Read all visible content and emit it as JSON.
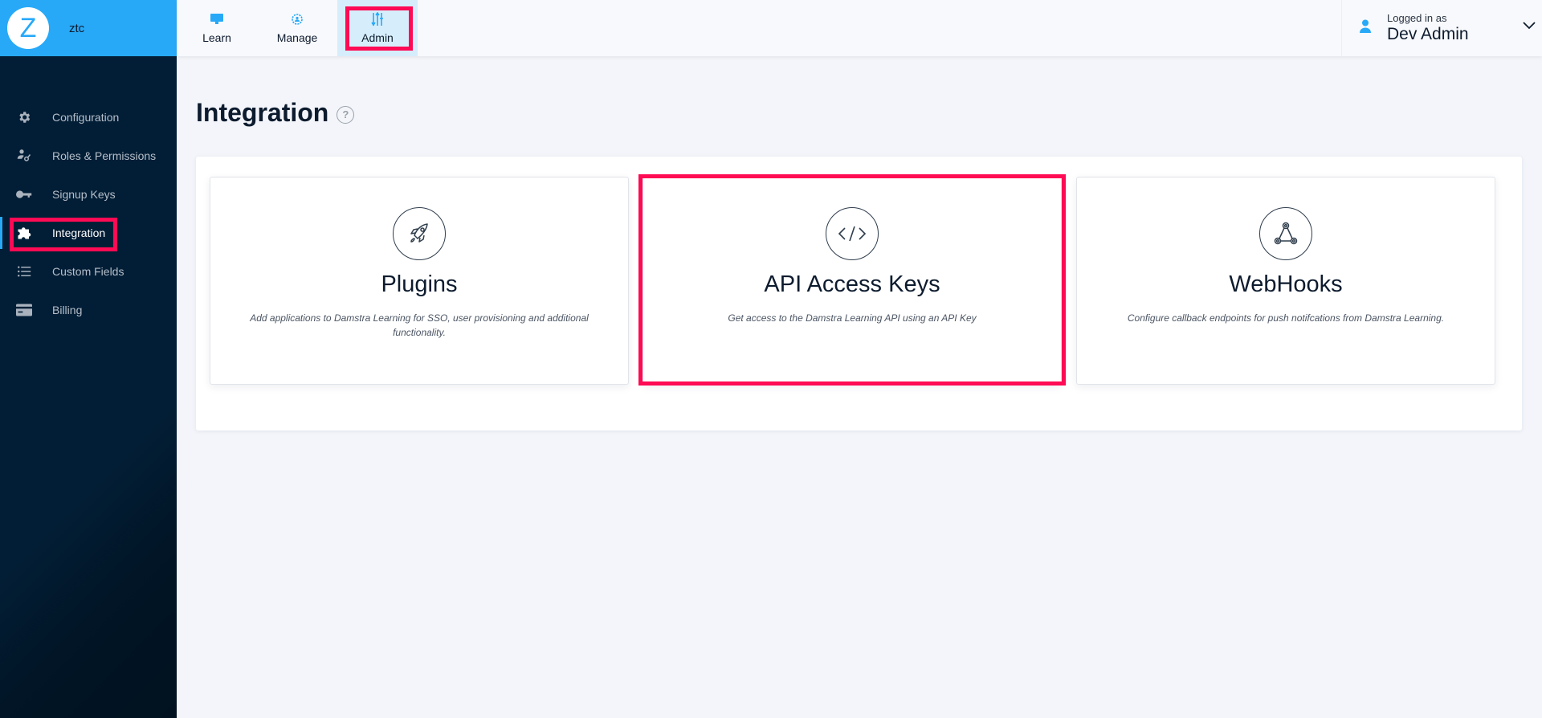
{
  "brand": {
    "logo_letter": "Z",
    "org_name": "ztc"
  },
  "nav": {
    "tabs": [
      {
        "label": "Learn",
        "icon": "monitor-icon",
        "active": false
      },
      {
        "label": "Manage",
        "icon": "gear-person-icon",
        "active": false
      },
      {
        "label": "Admin",
        "icon": "sliders-icon",
        "active": true
      }
    ]
  },
  "user": {
    "prefix": "Logged in as",
    "name": "Dev Admin",
    "icon": "user-icon",
    "menu_icon": "chevron-down-icon"
  },
  "sidebar": {
    "items": [
      {
        "label": "Configuration",
        "icon": "gear-icon",
        "active": false
      },
      {
        "label": "Roles & Permissions",
        "icon": "user-key-icon",
        "active": false
      },
      {
        "label": "Signup Keys",
        "icon": "key-icon",
        "active": false
      },
      {
        "label": "Integration",
        "icon": "puzzle-icon",
        "active": true
      },
      {
        "label": "Custom Fields",
        "icon": "list-icon",
        "active": false
      },
      {
        "label": "Billing",
        "icon": "credit-card-icon",
        "active": false
      }
    ]
  },
  "page": {
    "title": "Integration",
    "help_glyph": "?"
  },
  "cards": [
    {
      "title": "Plugins",
      "icon": "rocket-icon",
      "description": "Add applications to Damstra Learning for SSO, user provisioning and additional functionality."
    },
    {
      "title": "API Access Keys",
      "icon": "code-icon",
      "description": "Get access to the Damstra Learning API using an API Key"
    },
    {
      "title": "WebHooks",
      "icon": "webhook-icon",
      "description": "Configure callback endpoints for push notifcations from Damstra Learning."
    }
  ],
  "colors": {
    "accent": "#27a9f8",
    "sidebar": "#021e36",
    "highlight": "#ff0a54",
    "background": "#f3f5fa"
  }
}
